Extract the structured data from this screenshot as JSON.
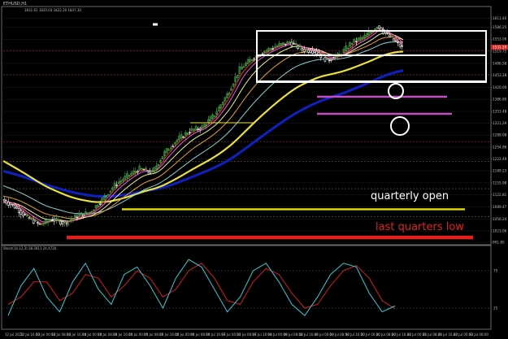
{
  "header": {
    "symbol_label": "ETHUSD,H1",
    "quote_line": "1831.61 1835.03 1822.20 1837.30"
  },
  "indicator": {
    "label": "Stoch(14,12,3) 28.2811 24.4720",
    "levels": [
      "75",
      "25"
    ]
  },
  "annotations": {
    "quarterly_open": "quarterly open",
    "last_quarters_low": "last quarters low"
  },
  "price_axis": {
    "labels": [
      "1611.40",
      "1586.25",
      "1553.06",
      "1519.75",
      "1486.58",
      "1453.28",
      "1420.00",
      "1386.80",
      "1353.48",
      "1321.29",
      "1288.08",
      "1254.86",
      "1222.49",
      "1189.23",
      "1155.98",
      "1122.81",
      "1089.47",
      "1056.24",
      "1023.06",
      "991.85"
    ]
  },
  "time_axis": {
    "labels": [
      "12 Jul 2022",
      "12 Jul 16:00",
      "13 Jul 00:00",
      "13 Jul 08:00",
      "13 Jul 16:00",
      "14 Jul 00:00",
      "14 Jul 08:00",
      "14 Jul 16:00",
      "15 Jul 00:00",
      "15 Jul 08:00",
      "15 Jul 16:00",
      "16 Jul 00:00",
      "16 Jul 08:00",
      "16 Jul 16:00",
      "17 Jul 00:00",
      "17 Jul 08:00",
      "17 Jul 16:00",
      "18 Jul 00:00",
      "18 Jul 08:00",
      "18 Jul 16:00",
      "19 Jul 00:00",
      "19 Jul 08:00",
      "19 Jul 16:00",
      "20 Jul 00:00",
      "20 Jul 08:00",
      "20 Jul 16:00",
      "21 Jul 00:00",
      "21 Jul 08:00",
      "21 Jul 16:00",
      "22 Jul 00:00",
      "22 Jul 08:00"
    ]
  },
  "colors": {
    "background": "#000000",
    "bull_candle": "#4caf50",
    "bear_candle": "#ffffff",
    "quarterly_open_line": "#e6e000",
    "last_quarters_low_line": "#e0201c",
    "blue_ma": "#1020c0",
    "yellow_ma": "#e8e040",
    "magenta_level": "#c050c0",
    "stoch_main": "#40c8d0",
    "stoch_signal": "#d02020",
    "annotation_white": "#ffffff",
    "annotation_red": "#e02020"
  },
  "chart_data": {
    "type": "line",
    "symbol": "ETHUSD",
    "timeframe": "H1",
    "ylim": [
      991.85,
      1630
    ],
    "price_path": [
      {
        "t": 0,
        "p": 1110
      },
      {
        "t": 6,
        "p": 1090
      },
      {
        "t": 12,
        "p": 1060
      },
      {
        "t": 18,
        "p": 1040
      },
      {
        "t": 24,
        "p": 1055
      },
      {
        "t": 30,
        "p": 1045
      },
      {
        "t": 36,
        "p": 1065
      },
      {
        "t": 42,
        "p": 1075
      },
      {
        "t": 48,
        "p": 1110
      },
      {
        "t": 54,
        "p": 1150
      },
      {
        "t": 60,
        "p": 1175
      },
      {
        "t": 66,
        "p": 1195
      },
      {
        "t": 72,
        "p": 1185
      },
      {
        "t": 78,
        "p": 1240
      },
      {
        "t": 84,
        "p": 1275
      },
      {
        "t": 90,
        "p": 1300
      },
      {
        "t": 96,
        "p": 1310
      },
      {
        "t": 102,
        "p": 1345
      },
      {
        "t": 108,
        "p": 1400
      },
      {
        "t": 114,
        "p": 1470
      },
      {
        "t": 120,
        "p": 1500
      },
      {
        "t": 126,
        "p": 1520
      },
      {
        "t": 132,
        "p": 1535
      },
      {
        "t": 138,
        "p": 1545
      },
      {
        "t": 144,
        "p": 1525
      },
      {
        "t": 150,
        "p": 1520
      },
      {
        "t": 156,
        "p": 1495
      },
      {
        "t": 162,
        "p": 1510
      },
      {
        "t": 168,
        "p": 1545
      },
      {
        "t": 174,
        "p": 1560
      },
      {
        "t": 180,
        "p": 1590
      },
      {
        "t": 186,
        "p": 1560
      },
      {
        "t": 192,
        "p": 1530
      }
    ],
    "horizontal_levels": [
      {
        "name": "quarterly open",
        "price": 1083,
        "color": "#e6e000"
      },
      {
        "name": "last quarters low",
        "price": 1005,
        "color": "#e0201c"
      }
    ],
    "stochastic": {
      "levels": [
        75,
        25
      ],
      "main": [
        15,
        55,
        78,
        40,
        20,
        60,
        85,
        50,
        30,
        70,
        80,
        55,
        25,
        65,
        90,
        80,
        50,
        20,
        40,
        75,
        85,
        60,
        30,
        15,
        40,
        70,
        85,
        80,
        45,
        20,
        28
      ],
      "signal": [
        30,
        40,
        60,
        60,
        35,
        45,
        70,
        65,
        40,
        55,
        75,
        65,
        40,
        50,
        75,
        85,
        65,
        35,
        30,
        60,
        78,
        70,
        45,
        25,
        30,
        55,
        75,
        82,
        65,
        35,
        24
      ]
    }
  }
}
